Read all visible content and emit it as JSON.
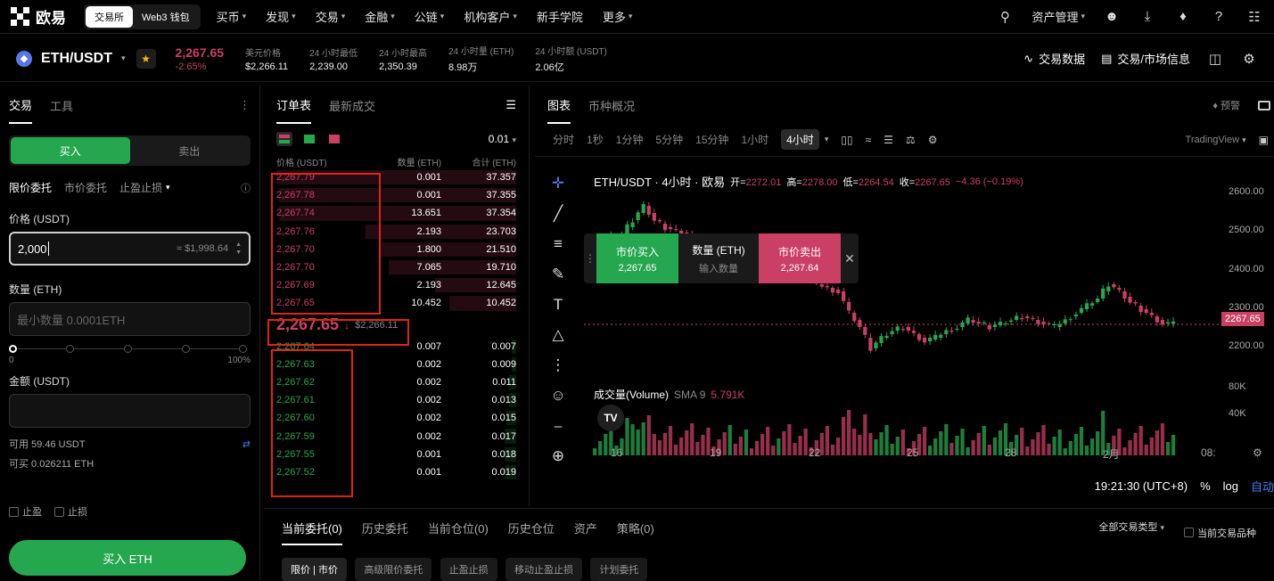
{
  "nav": {
    "brand": "欧易",
    "toggle": [
      "交易所",
      "Web3 钱包"
    ],
    "items": [
      "买币",
      "发现",
      "交易",
      "金融",
      "公链",
      "机构客户",
      "新手学院",
      "更多"
    ],
    "asset_mgmt": "资产管理"
  },
  "ticker": {
    "pair": "ETH/USDT",
    "price": "2,267.65",
    "change": "-2.65%",
    "stats": [
      {
        "label": "美元价格",
        "value": "$2,266.11"
      },
      {
        "label": "24 小时最低",
        "value": "2,239.00"
      },
      {
        "label": "24 小时最高",
        "value": "2,350.39"
      },
      {
        "label": "24 小时量 (ETH)",
        "value": "8.98万"
      },
      {
        "label": "24 小时额 (USDT)",
        "value": "2.06亿"
      }
    ],
    "trade_data": "交易数据",
    "market_info": "交易/市场信息"
  },
  "left": {
    "tabs": [
      "交易",
      "工具"
    ],
    "buy": "买入",
    "sell": "卖出",
    "order_types": [
      "限价委托",
      "市价委托",
      "止盈止损"
    ],
    "price_label": "价格 (USDT)",
    "price_value": "2,000",
    "price_hint": "≈ $1,998.64",
    "qty_label": "数量 (ETH)",
    "qty_placeholder": "最小数量 0.0001ETH",
    "slider_min": "0",
    "slider_max": "100%",
    "amount_label": "金额 (USDT)",
    "available": "可用 59.46 USDT",
    "can_buy": "可买 0.026211 ETH",
    "tp": "止盈",
    "sl": "止损",
    "submit": "买入 ETH"
  },
  "orderbook": {
    "tabs": [
      "订单表",
      "最新成交"
    ],
    "precision": "0.01",
    "headers": [
      "价格 (USDT)",
      "数量 (ETH)",
      "合计 (ETH)"
    ],
    "asks": [
      {
        "price": "2,267.79",
        "qty": "0.001",
        "total": "37.357",
        "depth": 1.0
      },
      {
        "price": "2,267.78",
        "qty": "0.001",
        "total": "37.355",
        "depth": 0.99
      },
      {
        "price": "2,267.74",
        "qty": "13.651",
        "total": "37.354",
        "depth": 0.99
      },
      {
        "price": "2,267.76",
        "qty": "2.193",
        "total": "23.703",
        "depth": 0.63
      },
      {
        "price": "2,267.70",
        "qty": "1.800",
        "total": "21.510",
        "depth": 0.57
      },
      {
        "price": "2,267.70",
        "qty": "7.065",
        "total": "19.710",
        "depth": 0.53
      },
      {
        "price": "2,267.69",
        "qty": "2.193",
        "total": "12.645",
        "depth": 0.34
      },
      {
        "price": "2,267.65",
        "qty": "10.452",
        "total": "10.452",
        "depth": 0.28
      }
    ],
    "mid_price": "2,267.65",
    "mid_usd": "$2,266.11",
    "bids": [
      {
        "price": "2,267.64",
        "qty": "0.007",
        "total": "0.007",
        "depth": 0.02
      },
      {
        "price": "2,267.63",
        "qty": "0.002",
        "total": "0.009",
        "depth": 0.02
      },
      {
        "price": "2,267.62",
        "qty": "0.002",
        "total": "0.011",
        "depth": 0.03
      },
      {
        "price": "2,267.61",
        "qty": "0.002",
        "total": "0.013",
        "depth": 0.03
      },
      {
        "price": "2,267.60",
        "qty": "0.002",
        "total": "0.015",
        "depth": 0.04
      },
      {
        "price": "2,267.59",
        "qty": "0.002",
        "total": "0.017",
        "depth": 0.05
      },
      {
        "price": "2,267.55",
        "qty": "0.001",
        "total": "0.018",
        "depth": 0.05
      },
      {
        "price": "2,267.52",
        "qty": "0.001",
        "total": "0.019",
        "depth": 0.05
      }
    ]
  },
  "chart": {
    "tabs": [
      "图表",
      "币种概况"
    ],
    "alert": "预警",
    "intervals": [
      "分时",
      "1秒",
      "1分钟",
      "5分钟",
      "15分钟",
      "1小时",
      "4小时"
    ],
    "active_interval": "4小时",
    "provider": "TradingView",
    "title": "ETH/USDT · 4小时 · 欧易",
    "ohlc": [
      {
        "k": "开=",
        "v": "2272.01"
      },
      {
        "k": "高=",
        "v": "2278.00"
      },
      {
        "k": "低=",
        "v": "2264.54"
      },
      {
        "k": "收=",
        "v": "2267.65"
      },
      {
        "k": "",
        "v": "−4.36 (−0.19%)"
      }
    ],
    "quick": {
      "buy": "市价买入",
      "buy_price": "2,267.65",
      "qty": "数量 (ETH)",
      "qty_ph": "输入数量",
      "sell": "市价卖出",
      "sell_price": "2,267.64"
    },
    "volume_label": "成交量(Volume)",
    "sma": "SMA 9",
    "sma_value": "5.791K",
    "price_ticks": [
      "2600.00",
      "2500.00",
      "2400.00",
      "2300.00",
      "2200.00"
    ],
    "vol_ticks": [
      "80K",
      "40K"
    ],
    "last_price": "2267.65",
    "date_ticks": [
      "16",
      "19",
      "22",
      "25",
      "28",
      "2月",
      "08:"
    ],
    "time": "19:21:30 (UTC+8)",
    "pct": "%",
    "log": "log",
    "auto": "自动"
  },
  "chart_data": {
    "type": "candlestick",
    "title": "ETH/USDT · 4小时 · 欧易",
    "ylim": [
      2150,
      2650
    ],
    "x": [
      "16",
      "19",
      "22",
      "25",
      "28",
      "2月"
    ],
    "close_path": [
      2480,
      2500,
      2510,
      2520,
      2560,
      2600,
      2560,
      2540,
      2530,
      2520,
      2500,
      2490,
      2470,
      2460,
      2450,
      2450,
      2440,
      2430,
      2420,
      2410,
      2400,
      2380,
      2370,
      2360,
      2300,
      2260,
      2200,
      2230,
      2250,
      2260,
      2240,
      2220,
      2230,
      2250,
      2260,
      2280,
      2270,
      2260,
      2270,
      2280,
      2290,
      2280,
      2270,
      2260,
      2280,
      2300,
      2320,
      2340,
      2380,
      2360,
      2330,
      2310,
      2290,
      2270,
      2267.65
    ]
  },
  "bottom": {
    "tabs": [
      "当前委托(0)",
      "历史委托",
      "当前仓位(0)",
      "历史仓位",
      "资产",
      "策略(0)"
    ],
    "type_filter": "全部交易类型",
    "current_pair": "当前交易品种",
    "pills": [
      "限价 | 市价",
      "高级限价委托",
      "止盈止损",
      "移动止盈止损",
      "计划委托"
    ]
  },
  "colors": {
    "buy": "#25a750",
    "sell": "#ca3f64",
    "highlight": "#e0231b"
  }
}
